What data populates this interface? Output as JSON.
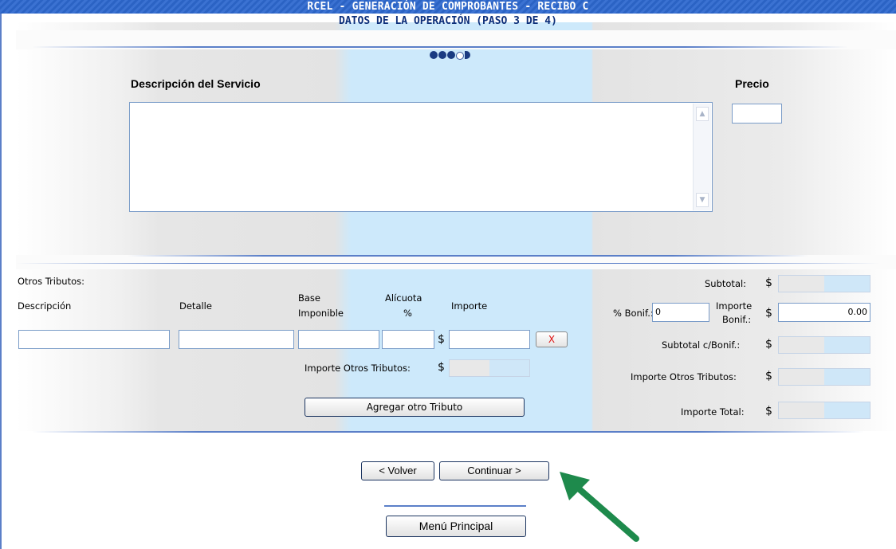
{
  "header": {
    "title": "RCEL - GENERACIÓN DE COMPROBANTES - RECIBO C",
    "subtitle": "DATOS DE LA OPERACIÓN (PASO 3 DE 4)",
    "progress": {
      "current_step": 3,
      "total_steps": 4
    }
  },
  "servicio": {
    "descripcion_label": "Descripción del Servicio",
    "descripcion_value": "",
    "precio_label": "Precio",
    "precio_value": ""
  },
  "otros_tributos": {
    "section_label": "Otros Tributos:",
    "col_descripcion": "Descripción",
    "col_detalle": "Detalle",
    "col_base_1": "Base",
    "col_base_2": "Imponible",
    "col_alicuota_1": "Alícuota",
    "col_alicuota_2": "%",
    "col_importe": "Importe",
    "currency": "$",
    "remove_label": "X",
    "total_label": "Importe Otros Tributos:",
    "add_button": "Agregar otro Tributo"
  },
  "totales": {
    "subtotal_label": "Subtotal:",
    "bonif_pct_label": "% Bonif.:",
    "bonif_pct_value": "0",
    "importe_bonif_label_1": "Importe",
    "importe_bonif_label_2": "Bonif.:",
    "importe_bonif_value": "0.00",
    "subtotal_bonif_label": "Subtotal c/Bonif.:",
    "otros_tributos_label": "Importe Otros Tributos:",
    "total_label": "Importe Total:",
    "currency": "$"
  },
  "nav": {
    "back": "< Volver",
    "next": "Continuar >",
    "menu": "Menú Principal"
  },
  "colors": {
    "title_bar": "#2b63c4",
    "accent_column": "#cde9fb",
    "border": "#1c3560",
    "annotation_arrow": "#1e8a4c"
  },
  "annotation": {
    "target": "continue-button",
    "icon": "green-arrow-icon"
  }
}
